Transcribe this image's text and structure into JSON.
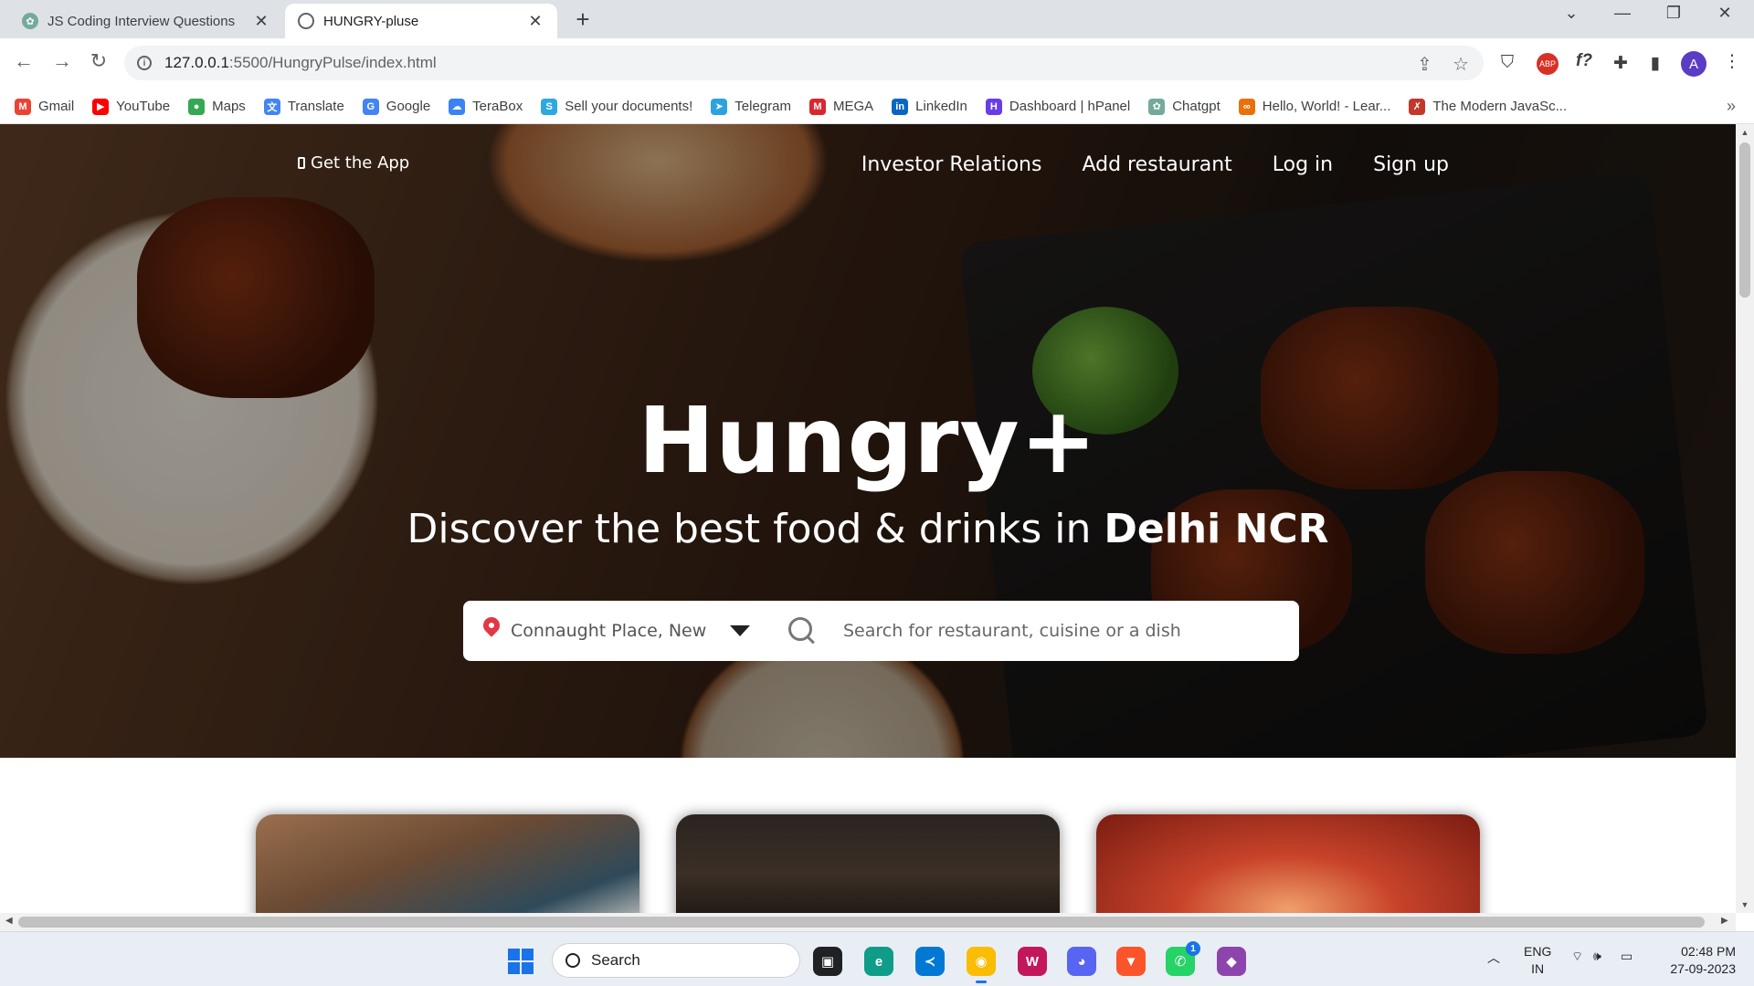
{
  "browser": {
    "tabs": [
      {
        "title": "JS Coding Interview Questions",
        "active": false
      },
      {
        "title": "HUNGRY-pluse",
        "active": true
      }
    ],
    "url_host": "127.0.0.1",
    "url_path": ":5500/HungryPulse/index.html",
    "profile_initial": "A",
    "bookmarks": [
      {
        "label": "Gmail",
        "icon": "gmail-icon",
        "color": "#ea4335",
        "glyph": "M"
      },
      {
        "label": "YouTube",
        "icon": "youtube-icon",
        "color": "#ff0000",
        "glyph": "▶"
      },
      {
        "label": "Maps",
        "icon": "maps-icon",
        "color": "#34a853",
        "glyph": "●"
      },
      {
        "label": "Translate",
        "icon": "translate-icon",
        "color": "#4285f4",
        "glyph": "文"
      },
      {
        "label": "Google",
        "icon": "google-icon",
        "color": "#4285f4",
        "glyph": "G"
      },
      {
        "label": "TeraBox",
        "icon": "terabox-icon",
        "color": "#3b82f6",
        "glyph": "☁"
      },
      {
        "label": "Sell your documents!",
        "icon": "sell-docs-icon",
        "color": "#2ea8e0",
        "glyph": "S"
      },
      {
        "label": "Telegram",
        "icon": "telegram-icon",
        "color": "#2aa3df",
        "glyph": "➤"
      },
      {
        "label": "MEGA",
        "icon": "mega-icon",
        "color": "#d9272e",
        "glyph": "M"
      },
      {
        "label": "LinkedIn",
        "icon": "linkedin-icon",
        "color": "#0a66c2",
        "glyph": "in"
      },
      {
        "label": "Dashboard | hPanel",
        "icon": "hostinger-icon",
        "color": "#673de6",
        "glyph": "H"
      },
      {
        "label": "Chatgpt",
        "icon": "chatgpt-icon",
        "color": "#74aa9c",
        "glyph": "✿"
      },
      {
        "label": "Hello, World! - Lear...",
        "icon": "hello-world-icon",
        "color": "#e8710a",
        "glyph": "∞"
      },
      {
        "label": "The Modern JavaSc...",
        "icon": "javascript-info-icon",
        "color": "#c0392b",
        "glyph": "✗"
      }
    ],
    "more_bookmarks": "»"
  },
  "page": {
    "get_app": "Get the App",
    "nav": [
      "Investor Relations",
      "Add restaurant",
      "Log in",
      "Sign up"
    ],
    "brand": "Hungry+",
    "tagline_prefix": "Discover the best food & drinks in ",
    "tagline_city": "Delhi NCR",
    "location_value": "Connaught Place, New Delhi",
    "search_placeholder": "Search for restaurant, cuisine or a dish",
    "accent": "#e23744"
  },
  "taskbar": {
    "search_label": "Search",
    "lang_primary": "ENG",
    "lang_secondary": "IN",
    "time": "02:48 PM",
    "date": "27-09-2023",
    "whatsapp_badge": "1"
  }
}
